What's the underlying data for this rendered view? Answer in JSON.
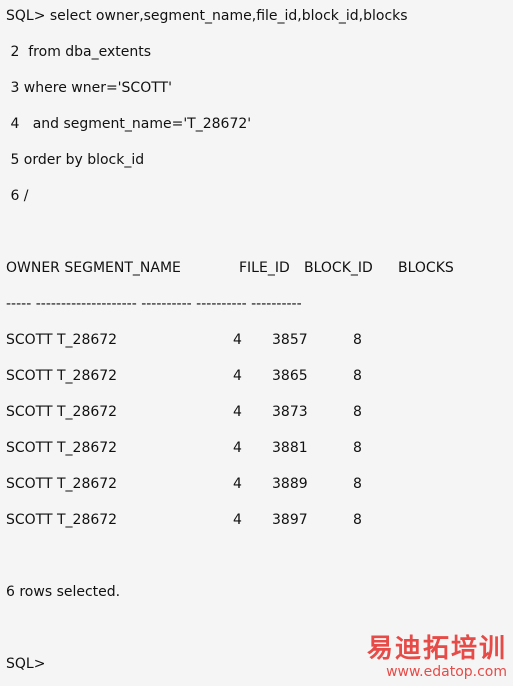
{
  "query": {
    "line1": "SQL> select owner,segment_name,file_id,block_id,blocks",
    "line2": " 2  from dba_extents",
    "line3": " 3 where wner='SCOTT'",
    "line4": " 4   and segment_name='T_28672'",
    "line5": " 5 order by block_id",
    "line6": " 6 /"
  },
  "result": {
    "headers": {
      "owner_segment": "OWNER SEGMENT_NAME",
      "file_id": "FILE_ID",
      "block_id": "BLOCK_ID",
      "blocks": "BLOCKS"
    },
    "separator": "----- -------------------- ---------- ---------- ----------",
    "rows": [
      {
        "owner_segment": "SCOTT T_28672",
        "file_id": "4",
        "block_id": "3857",
        "blocks": "8"
      },
      {
        "owner_segment": "SCOTT T_28672",
        "file_id": "4",
        "block_id": "3865",
        "blocks": "8"
      },
      {
        "owner_segment": "SCOTT T_28672",
        "file_id": "4",
        "block_id": "3873",
        "blocks": "8"
      },
      {
        "owner_segment": "SCOTT T_28672",
        "file_id": "4",
        "block_id": "3881",
        "blocks": "8"
      },
      {
        "owner_segment": "SCOTT T_28672",
        "file_id": "4",
        "block_id": "3889",
        "blocks": "8"
      },
      {
        "owner_segment": "SCOTT T_28672",
        "file_id": "4",
        "block_id": "3897",
        "blocks": "8"
      }
    ],
    "footer": "6 rows selected."
  },
  "prompt": "SQL>",
  "watermark": {
    "main": "易迪拓培训",
    "sub": "www.edatop.com"
  }
}
